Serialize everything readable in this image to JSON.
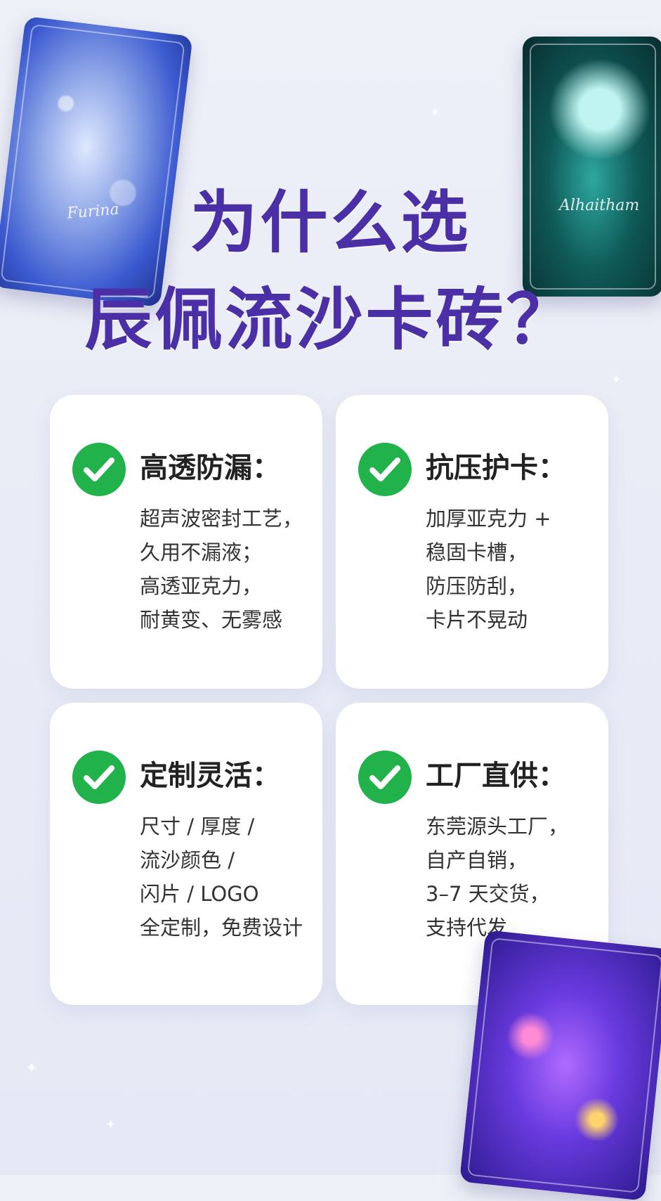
{
  "title": {
    "line1": "为什么选",
    "line2": "辰佩流沙卡砖？"
  },
  "decor_cards": {
    "left_signature": "Furina",
    "right_signature": "Alhaitham"
  },
  "features": [
    {
      "title": "高透防漏：",
      "lines": [
        "超声波密封工艺，",
        "久用不漏液；",
        "高透亚克力，",
        "耐黄变、无雾感"
      ]
    },
    {
      "title": "抗压护卡：",
      "lines": [
        "加厚亚克力 +",
        "稳固卡槽，",
        "防压防刮，",
        "卡片不晃动"
      ]
    },
    {
      "title": "定制灵活：",
      "lines": [
        "尺寸 / 厚度 /",
        "流沙颜色 /",
        "闪片 / LOGO",
        "全定制，免费设计"
      ]
    },
    {
      "title": "工厂直供：",
      "lines": [
        "东莞源头工厂，",
        "自产自销，",
        "3–7 天交货，",
        "支持代发"
      ]
    }
  ],
  "colors": {
    "title": "#4a2fa6",
    "check": "#22b24c",
    "card_bg": "#ffffff",
    "page_bg": "#eceef7"
  },
  "icons": {
    "feature_icon": "check-circle-icon"
  }
}
